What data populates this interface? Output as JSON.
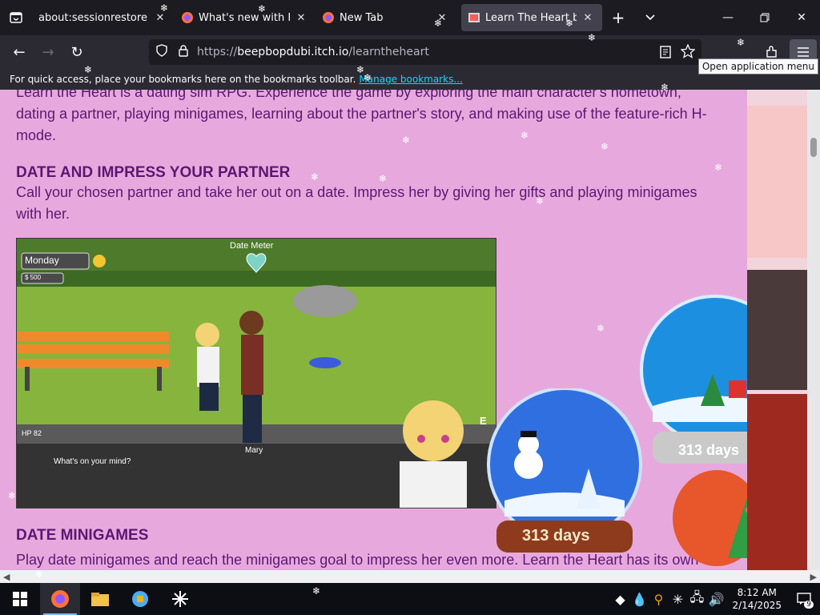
{
  "tabs": [
    {
      "label": "about:sessionrestore",
      "favicon": "none"
    },
    {
      "label": "What's new with Firefox",
      "favicon": "firefox-icon"
    },
    {
      "label": "New Tab",
      "favicon": "firefox-icon"
    },
    {
      "label": "Learn The Heart by bee",
      "favicon": "itchio-icon",
      "active": true
    }
  ],
  "url": {
    "prefix": "https://",
    "domain": "beepbopdubi.itch.io",
    "path": "/learntheheart"
  },
  "bookmarks": {
    "text": "For quick access, place your bookmarks here on the bookmarks toolbar.",
    "link": "Manage bookmarks..."
  },
  "tooltip": "Open application menu",
  "page": {
    "intro": "Learn the Heart is a dating sim RPG. Experience the game by exploring the main character's hometown, dating a partner, playing minigames, learning about the partner's story, and making use of the feature-rich H-mode.",
    "date_heading": "DATE AND IMPRESS YOUR PARTNER",
    "date_text": "Call your chosen partner and take her out on a date. Impress her by giving her gifts and playing minigames with her.",
    "mini_heading": "DATE MINIGAMES",
    "mini_text": "Play date minigames and reach the minigames goal to impress her even more. Learn the Heart has its own"
  },
  "game": {
    "day": "Monday",
    "money": "$ 500",
    "meter": "Date Meter",
    "name": "Mary",
    "dialog": "What's on your mind?",
    "hp": "HP 82",
    "side_label": "E"
  },
  "globes": {
    "days1": "313 days",
    "days2": "313 days"
  },
  "clock": {
    "time": "8:12 AM",
    "date": "2/14/2025"
  },
  "notif_count": "9",
  "colors": {
    "page_bg": "#e7a9dd",
    "page_text": "#5b1773",
    "chrome_dark": "#1c1b22",
    "chrome": "#2b2a33"
  }
}
